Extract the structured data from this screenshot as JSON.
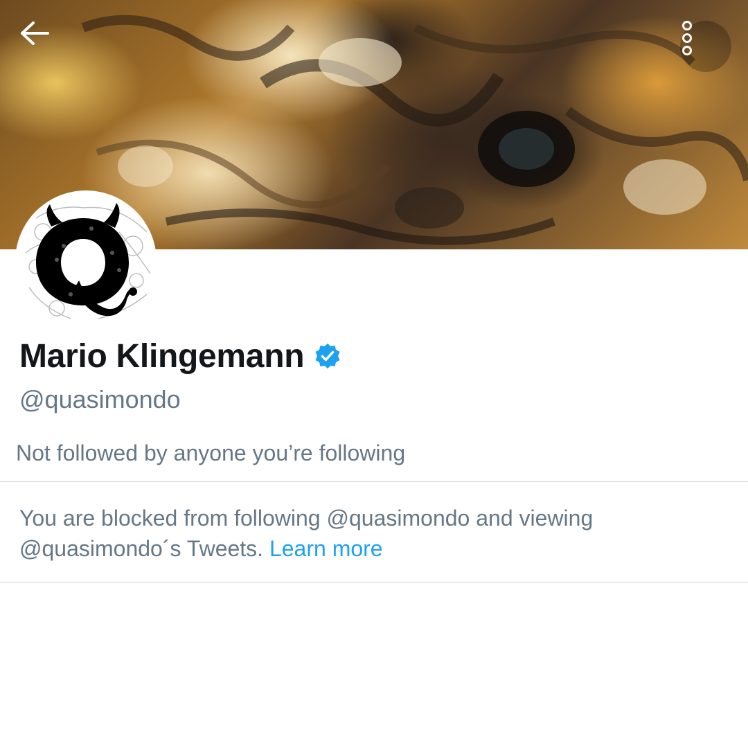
{
  "header": {
    "back_icon": "arrow-left-icon",
    "more_icon": "more-vertical-icon",
    "banner_colors": [
      "#e9c25e",
      "#3a2a1f",
      "#f1dcb0",
      "#c08a3b"
    ]
  },
  "profile": {
    "display_name": "Mario Klingemann",
    "verified": true,
    "verified_icon": "verified-badge-icon",
    "verified_color": "#1da1f2",
    "handle": "@quasimondo",
    "avatar_icon": "q-devil-logo-avatar",
    "followed_by_text": "Not followed by anyone you’re following"
  },
  "blocked_notice": {
    "message": "You are blocked from following @quasimondo and viewing @quasimondo´s Tweets.",
    "link_label": "Learn more",
    "link_color": "#1da1f2"
  }
}
